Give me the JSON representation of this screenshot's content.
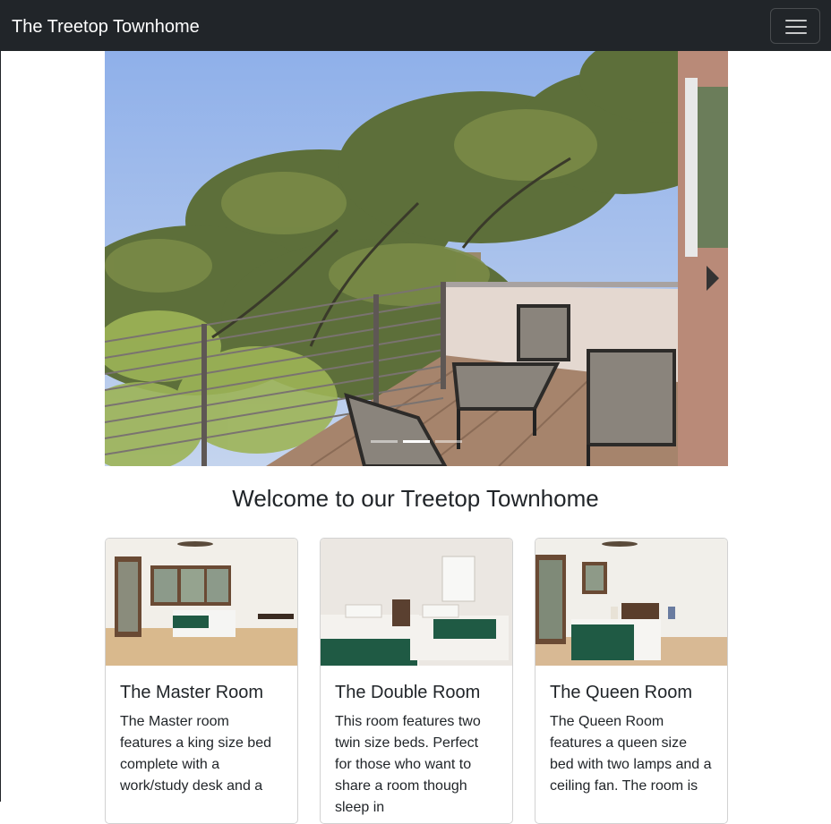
{
  "navbar": {
    "brand": "The Treetop Townhome",
    "toggler_icon": "hamburger-menu-icon"
  },
  "carousel": {
    "slide_count": 3,
    "active_slide": 2,
    "slide_description": "Balcony with wicker chairs, glass-top table and cable railing overlooking oak trees"
  },
  "main": {
    "heading": "Welcome to our Treetop Townhome"
  },
  "rooms": [
    {
      "title": "The Master Room",
      "text": "The Master room features a king size bed complete with a work/study desk and a"
    },
    {
      "title": "The Double Room",
      "text": "This room features two twin size beds. Perfect for those who want to share a room though sleep in"
    },
    {
      "title": "The Queen Room",
      "text": "The Queen Room features a queen size bed with two lamps and a ceiling fan. The room is"
    }
  ],
  "colors": {
    "navbar_bg": "#212529",
    "text": "#212529",
    "bed_throw": "#1f5a44"
  }
}
